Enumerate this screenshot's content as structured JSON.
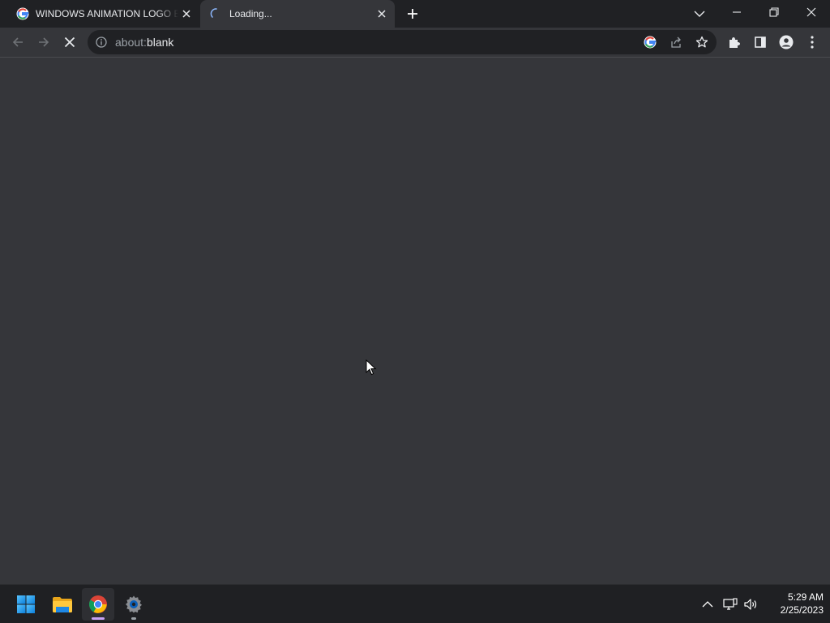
{
  "browser": {
    "tabs": [
      {
        "title": "WINDOWS ANIMATION LOGO EFFECTS",
        "favicon": "google-g-icon",
        "active": false
      },
      {
        "title": "Loading...",
        "favicon": "loading-spinner-icon",
        "active": true
      }
    ],
    "omnibox": {
      "url_scheme": "about:",
      "url_rest": "blank"
    }
  },
  "taskbar": {
    "apps": [
      "windows-start-icon",
      "file-explorer-icon",
      "chrome-icon",
      "settings-icon"
    ],
    "clock": {
      "time": "5:29 AM",
      "date": "2/25/2023"
    }
  },
  "colors": {
    "tabstrip": "#202124",
    "content": "#35363a",
    "omnibox": "#202124",
    "taskbar": "#1f2023",
    "accent": "#8ab4f8"
  }
}
